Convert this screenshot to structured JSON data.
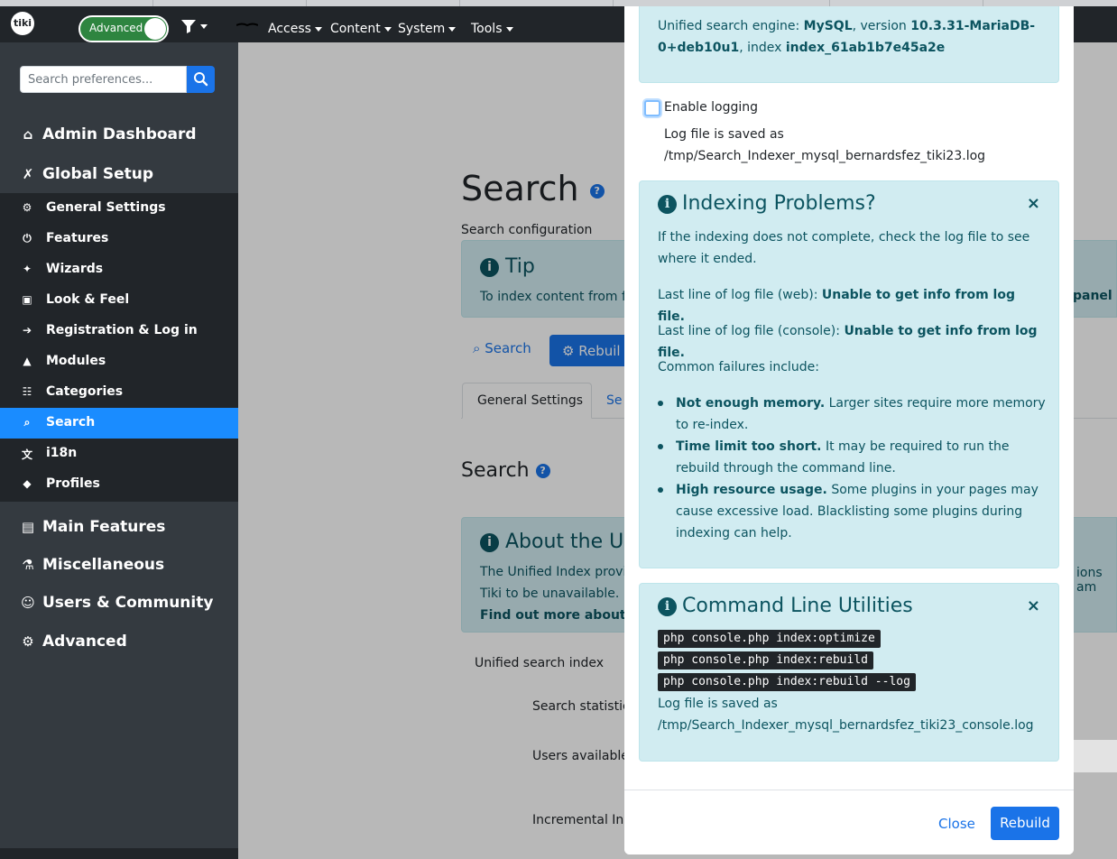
{
  "navbar": {
    "logo_text": "tiki",
    "mode_toggle": "Advanced",
    "menus": [
      "Access",
      "Content",
      "System",
      "Tools"
    ]
  },
  "sidebar": {
    "search_placeholder": "Search preferences...",
    "headings": {
      "admin_dashboard": "Admin Dashboard",
      "global_setup": "Global Setup",
      "main_features": "Main Features",
      "miscellaneous": "Miscellaneous",
      "users_community": "Users & Community",
      "advanced": "Advanced"
    },
    "items": [
      {
        "label": "General Settings",
        "icon": "gear-icon"
      },
      {
        "label": "Features",
        "icon": "power-icon"
      },
      {
        "label": "Wizards",
        "icon": "magic-wand-icon"
      },
      {
        "label": "Look & Feel",
        "icon": "image-icon"
      },
      {
        "label": "Registration & Log in",
        "icon": "sign-in-icon"
      },
      {
        "label": "Modules",
        "icon": "shapes-icon"
      },
      {
        "label": "Categories",
        "icon": "sitemap-icon"
      },
      {
        "label": "Search",
        "icon": "search-icon",
        "active": true
      },
      {
        "label": "i18n",
        "icon": "language-icon"
      },
      {
        "label": "Profiles",
        "icon": "cube-icon"
      }
    ]
  },
  "main": {
    "title": "Search",
    "subtitle": "Search configuration",
    "tip_title": "Tip",
    "tip_text": "To index content from fi",
    "tip_right": "panel",
    "search_button": "Search",
    "rebuild_button": "Rebuil",
    "tab_general": "General Settings",
    "tab_other": "Se",
    "section_title": "Search",
    "about_title": "About the Un",
    "about_line1": "The Unified Index provid",
    "about_line2": "Tiki to be unavailable.",
    "about_line3": "Find out more about it h",
    "about_right": "ions am",
    "unified_index_label": "Unified search index",
    "stats_label": "Search statistic",
    "users_label": "Users available",
    "incremental_label": "Incremental Ind"
  },
  "modal": {
    "engine_prefix": "Unified search engine:",
    "engine_name": "MySQL",
    "engine_version_prefix": ", version",
    "engine_version": "10.3.31-MariaDB-0+deb10u1",
    "engine_index_prefix": ", index",
    "engine_index": "index_61ab1b7e45a2e",
    "logging_label": "Enable logging",
    "logging_checked": false,
    "logfile_prefix": "Log file is saved as",
    "logfile_path": "/tmp/Search_Indexer_mysql_bernardsfez_tiki23.log",
    "problems": {
      "title": "Indexing Problems?",
      "intro_1": "If the indexing does not complete, check the log file to see",
      "intro_2": "where it ended.",
      "web_prefix": "Last line of log file (web):",
      "web_value": "Unable to get info from log file.",
      "console_prefix": "Last line of log file (console):",
      "console_value": "Unable to get info from log file.",
      "common_failures": "Common failures include:",
      "bullets": [
        {
          "bold": "Not enough memory.",
          "text_1": "Larger sites require more memory",
          "text_2": "to re-index."
        },
        {
          "bold": "Time limit too short.",
          "text_1": "It may be required to run the",
          "text_2": "rebuild through the command line."
        },
        {
          "bold": "High resource usage.",
          "text_1": "Some plugins in your pages may",
          "text_2": "cause excessive load. Blacklisting some plugins during",
          "text_3": "indexing can help."
        }
      ]
    },
    "cli": {
      "title": "Command Line Utilities",
      "commands": [
        "php console.php index:optimize",
        "php console.php index:rebuild",
        "php console.php index:rebuild --log"
      ],
      "logfile_prefix": "Log file is saved as",
      "logfile_path": "/tmp/Search_Indexer_mysql_bernardsfez_tiki23_console.log"
    },
    "footer": {
      "close": "Close",
      "rebuild": "Rebuild"
    }
  },
  "colors": {
    "primary": "#1a73e8",
    "sidebar_bg": "#343a40",
    "navbar_bg": "#212529",
    "alert_bg": "#d1ecf1",
    "alert_text": "#0c5460",
    "toggle_green": "#2e8540"
  }
}
